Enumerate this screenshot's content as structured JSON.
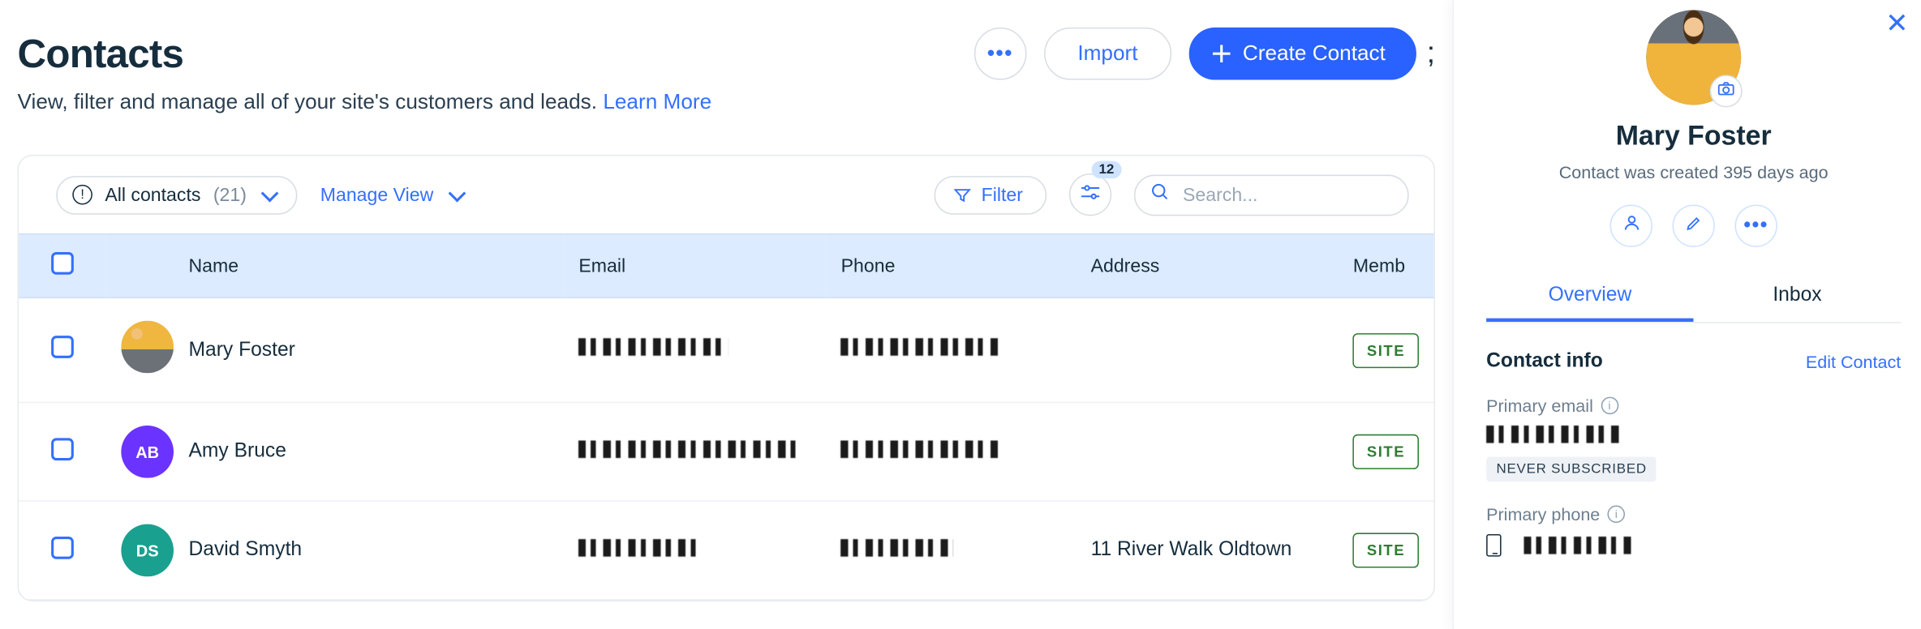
{
  "page": {
    "title": "Contacts",
    "subtitle_pre": "View, filter and manage all of your site's customers and leads. ",
    "learn_more": "Learn More",
    "trailing_punct": ";"
  },
  "header_actions": {
    "more_label": "•••",
    "import": "Import",
    "create": "Create Contact"
  },
  "toolbar": {
    "view_name": "All contacts",
    "view_count": "(21)",
    "manage_view": "Manage View",
    "filter": "Filter",
    "adjust_badge": "12",
    "search_placeholder": "Search..."
  },
  "columns": {
    "name": "Name",
    "email": "Email",
    "phone": "Phone",
    "address": "Address",
    "member": "Memb"
  },
  "rows": [
    {
      "name": "Mary Foster",
      "avatar_type": "photo",
      "avatar_bg": "",
      "initials": "",
      "email_w": 120,
      "phone_w": 130,
      "address": "",
      "badge": "SITE"
    },
    {
      "name": "Amy Bruce",
      "avatar_type": "init",
      "avatar_bg": "#6b33ff",
      "initials": "AB",
      "email_w": 175,
      "phone_w": 130,
      "address": "",
      "badge": "SITE"
    },
    {
      "name": "David Smyth",
      "avatar_type": "init",
      "avatar_bg": "#1aa08f",
      "initials": "DS",
      "email_w": 100,
      "phone_w": 90,
      "address": "11 River Walk Oldtown",
      "badge": "SITE"
    }
  ],
  "panel": {
    "name": "Mary Foster",
    "created": "Contact was created 395 days ago",
    "tabs": {
      "overview": "Overview",
      "inbox": "Inbox"
    },
    "section_title": "Contact info",
    "edit": "Edit Contact",
    "primary_email_label": "Primary email",
    "email_redact_w": 110,
    "never_sub": "NEVER SUBSCRIBED",
    "primary_phone_label": "Primary phone",
    "phone_redact_w": 90
  }
}
